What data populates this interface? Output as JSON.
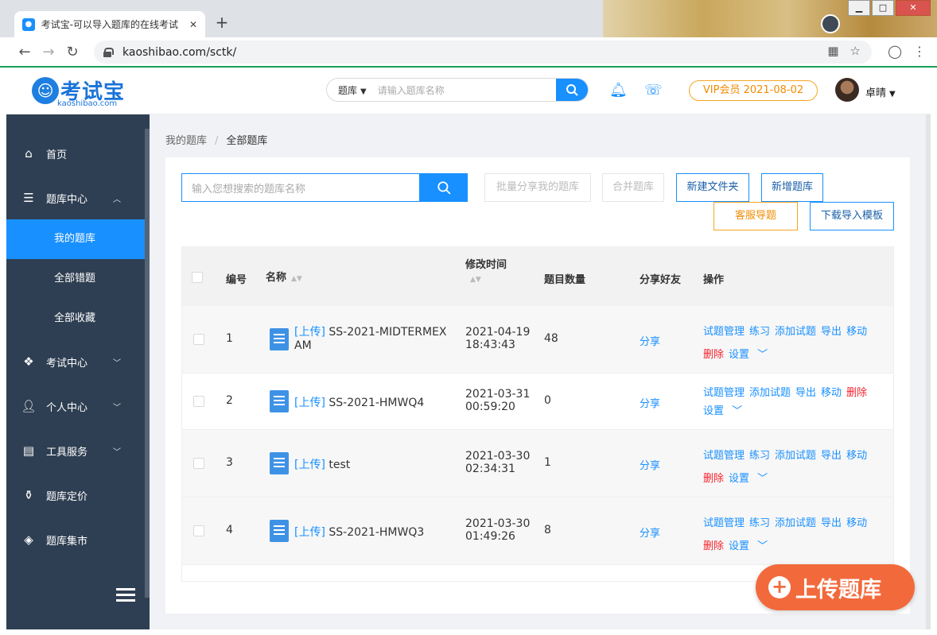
{
  "browser": {
    "tab_title": "考试宝-可以导入题库的在线考试",
    "url": "kaoshibao.com/sctk/"
  },
  "header": {
    "logo_text": "考试宝",
    "logo_sub": "kaoshibao.com",
    "search_scope": "题库",
    "search_placeholder": "请输入题库名称",
    "vip": "VIP会员 2021-08-02",
    "user_name": "卓晴"
  },
  "sidebar": {
    "items": [
      {
        "label": "首页"
      },
      {
        "label": "题库中心"
      },
      {
        "label": "我的题库"
      },
      {
        "label": "全部错题"
      },
      {
        "label": "全部收藏"
      },
      {
        "label": "考试中心"
      },
      {
        "label": "个人中心"
      },
      {
        "label": "工具服务"
      },
      {
        "label": "题库定价"
      },
      {
        "label": "题库集市"
      }
    ]
  },
  "breadcrumb": {
    "parent": "我的题库",
    "current": "全部题库"
  },
  "toolbar": {
    "search_placeholder": "输入您想搜索的题库名称",
    "batch_share": "批量分享我的题库",
    "merge": "合并题库",
    "new_folder": "新建文件夹",
    "new_bank": "新增题库",
    "service_guide": "客服导题",
    "download_template": "下载导入模板"
  },
  "table": {
    "headers": {
      "id": "编号",
      "name": "名称",
      "modified": "修改时间",
      "count": "题目数量",
      "share": "分享好友",
      "actions": "操作"
    },
    "rows": [
      {
        "id": "1",
        "tag": "[上传]",
        "name": "SS-2021-MIDTERMEX",
        "name2": "AM",
        "date": "2021-04-19",
        "time": "18:43:43",
        "count": "48",
        "share": "分享",
        "ops1": [
          "试题管理",
          "练习",
          "添加试题",
          "导出",
          "移动"
        ],
        "del": "删除",
        "setting": "设置"
      },
      {
        "id": "2",
        "tag": "[上传]",
        "name": "SS-2021-HMWQ4",
        "name2": "",
        "date": "2021-03-31",
        "time": "00:59:20",
        "count": "0",
        "share": "分享",
        "ops1": [
          "试题管理",
          "添加试题",
          "导出",
          "移动"
        ],
        "del": "删除",
        "setting": "设置"
      },
      {
        "id": "3",
        "tag": "[上传]",
        "name": "test",
        "name2": "",
        "date": "2021-03-30",
        "time": "02:34:31",
        "count": "1",
        "share": "分享",
        "ops1": [
          "试题管理",
          "练习",
          "添加试题",
          "导出",
          "移动"
        ],
        "del": "删除",
        "setting": "设置"
      },
      {
        "id": "4",
        "tag": "[上传]",
        "name": "SS-2021-HMWQ3",
        "name2": "",
        "date": "2021-03-30",
        "time": "01:49:26",
        "count": "8",
        "share": "分享",
        "ops1": [
          "试题管理",
          "练习",
          "添加试题",
          "导出",
          "移动"
        ],
        "del": "删除",
        "setting": "设置"
      }
    ]
  },
  "fab": {
    "label": "上传题库"
  },
  "colors": {
    "primary": "#1890ff",
    "sidebar": "#2f3f53",
    "danger": "#f5222d",
    "warning": "#f5a623",
    "fab": "#f26a3c"
  }
}
